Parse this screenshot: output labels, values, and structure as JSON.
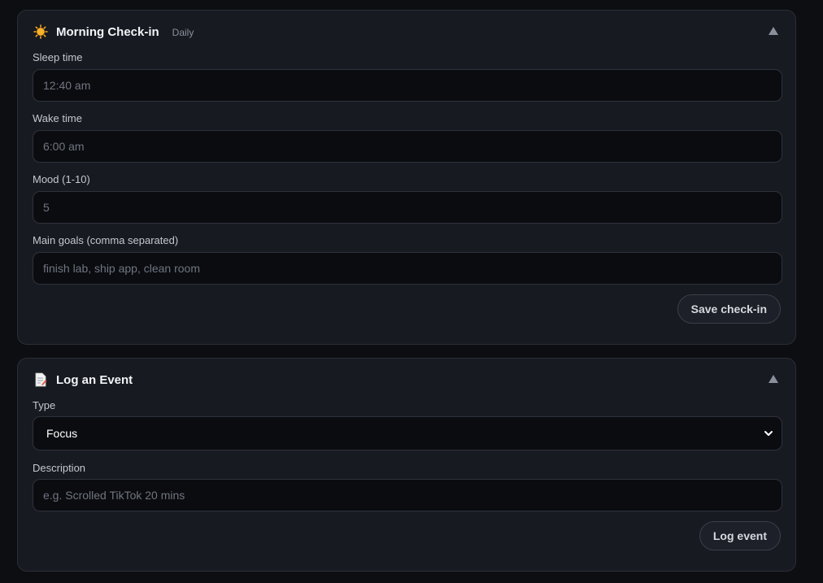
{
  "checkin": {
    "icon": "sun-icon",
    "title": "Morning Check-in",
    "badge": "Daily",
    "fields": [
      {
        "label": "Sleep time",
        "value": "12:40 am"
      },
      {
        "label": "Wake time",
        "value": "6:00 am"
      },
      {
        "label": "Mood (1-10)",
        "value": "5"
      },
      {
        "label": "Main goals (comma separated)",
        "placeholder": "finish lab, ship app, clean room"
      }
    ],
    "save_label": "Save check-in"
  },
  "event": {
    "icon": "memo-icon",
    "title": "Log an Event",
    "type_label": "Type",
    "type_value": "Focus",
    "description_label": "Description",
    "description_placeholder": "e.g. Scrolled TikTok 20 mins",
    "submit_label": "Log event"
  },
  "colors": {
    "background": "#0d0e11",
    "panel": "#171a21",
    "input": "#0b0c10",
    "border": "#2a2e37",
    "sun": "#f5a623"
  }
}
